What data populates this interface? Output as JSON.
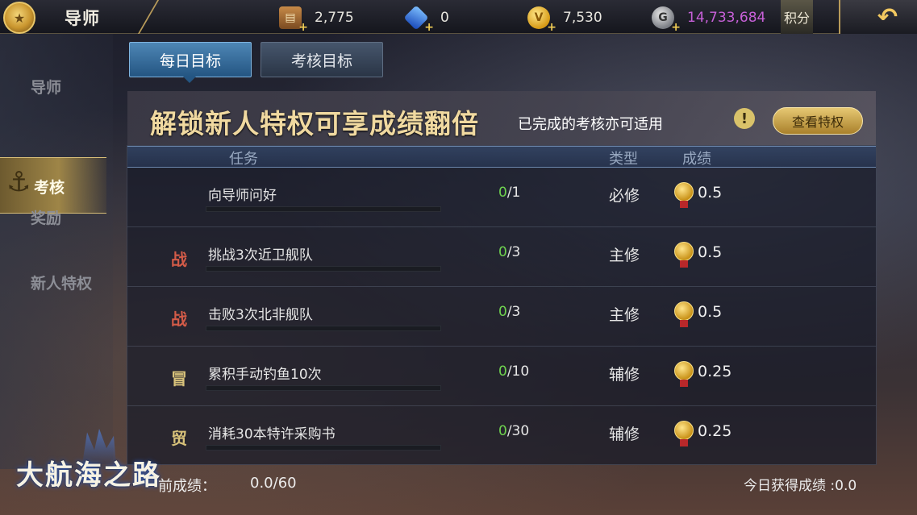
{
  "header": {
    "title": "导师",
    "resources": [
      {
        "icon": "chest-icon",
        "value": "2,775"
      },
      {
        "icon": "blue-gem-icon",
        "value": "0"
      },
      {
        "icon": "gold-coin-icon",
        "value": "7,530"
      },
      {
        "icon": "silver-coin-icon",
        "value": "14,733,684",
        "color": "#c760d8"
      }
    ],
    "score_button": "积分",
    "back_icon": "back-arrow-icon"
  },
  "sidebar": {
    "items": [
      {
        "label": "导师"
      },
      {
        "label": "考核",
        "active": true
      },
      {
        "label": "奖励"
      },
      {
        "label": "新人特权"
      }
    ]
  },
  "tabs": [
    {
      "label": "每日目标",
      "active": true
    },
    {
      "label": "考核目标",
      "active": false
    }
  ],
  "banner": {
    "title": "解锁新人特权可享成绩翻倍",
    "subtitle": "已完成的考核亦可适用",
    "alert_icon": "!",
    "button": "查看特权"
  },
  "table": {
    "headers": {
      "task": "任务",
      "type": "类型",
      "score": "成绩"
    },
    "rows": [
      {
        "tag": "",
        "task": "向导师问好",
        "done": "0",
        "total": "/1",
        "type": "必修",
        "score": "0.5"
      },
      {
        "tag": "战",
        "tag_color": "red",
        "task": "挑战3次近卫舰队",
        "done": "0",
        "total": "/3",
        "type": "主修",
        "score": "0.5"
      },
      {
        "tag": "战",
        "tag_color": "red",
        "task": "击败3次北非舰队",
        "done": "0",
        "total": "/3",
        "type": "主修",
        "score": "0.5"
      },
      {
        "tag": "冒",
        "tag_color": "gold",
        "task": "累积手动钓鱼10次",
        "done": "0",
        "total": "/10",
        "type": "辅修",
        "score": "0.25"
      },
      {
        "tag": "贸",
        "tag_color": "gold",
        "task": "消耗30本特许采购书",
        "done": "0",
        "total": "/30",
        "type": "辅修",
        "score": "0.25"
      }
    ]
  },
  "footer": {
    "logo": "大航海之路",
    "total_label": "前成绩：",
    "total_value": "0.0/60",
    "today": "今日获得成绩 :0.0"
  },
  "colors": {
    "accent_gold": "#d8be78",
    "progress_done": "#6fd34f",
    "tab_active": "#245582"
  }
}
